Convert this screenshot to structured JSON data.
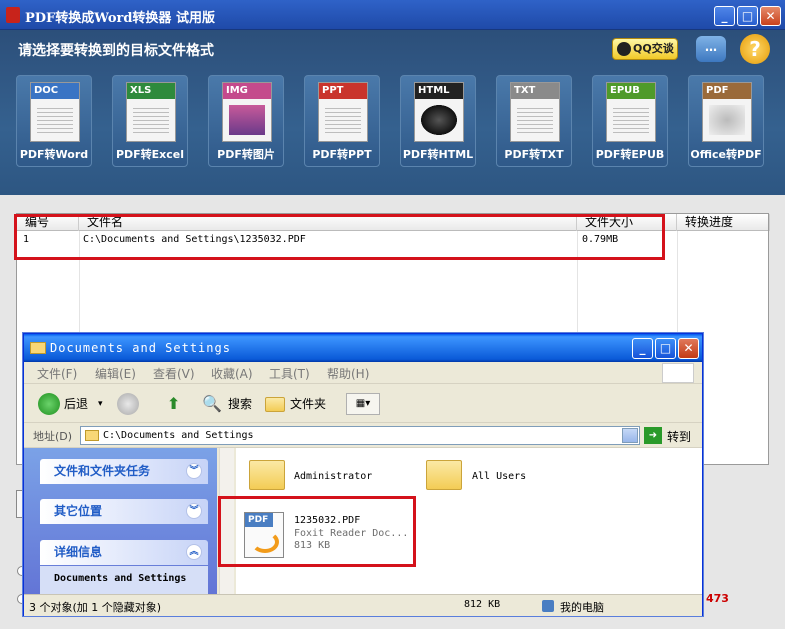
{
  "app": {
    "title": "PDF转换成Word转换器 试用版",
    "prompt": "请选择要转换到的目标文件格式",
    "qq_label": "QQ交谈",
    "help_label": "?",
    "conversions": [
      {
        "tag": "DOC",
        "label": "PDF转Word",
        "color": "#3a74c4"
      },
      {
        "tag": "XLS",
        "label": "PDF转Excel",
        "color": "#2e8a3c"
      },
      {
        "tag": "IMG",
        "label": "PDF转图片",
        "color": "#c44a8c"
      },
      {
        "tag": "PPT",
        "label": "PDF转PPT",
        "color": "#c9342c"
      },
      {
        "tag": "HTML",
        "label": "PDF转HTML",
        "color": "#222222"
      },
      {
        "tag": "TXT",
        "label": "PDF转TXT",
        "color": "#8a8a8a"
      },
      {
        "tag": "EPUB",
        "label": "PDF转EPUB",
        "color": "#4f9a2a"
      },
      {
        "tag": "PDF",
        "label": "Office转PDF",
        "color": "#9a6a3a"
      }
    ],
    "table": {
      "headers": [
        "编号",
        "文件名",
        "文件大小",
        "转换进度"
      ],
      "rows": [
        {
          "num": "1",
          "name": "C:\\Documents and Settings\\1235032.PDF",
          "size": "0.79MB",
          "progress": ""
        }
      ]
    },
    "status_right": "473",
    "highlight_color": "#d4121b"
  },
  "explorer": {
    "title": "Documents and Settings",
    "menu": [
      "文件(F)",
      "编辑(E)",
      "查看(V)",
      "收藏(A)",
      "工具(T)",
      "帮助(H)"
    ],
    "toolbar": {
      "back": "后退",
      "search": "搜索",
      "folders": "文件夹"
    },
    "address_label": "地址(D)",
    "address_value": "C:\\Documents and Settings",
    "go_label": "转到",
    "sidebar": [
      {
        "label": "文件和文件夹任务"
      },
      {
        "label": "其它位置"
      },
      {
        "label": "详细信息"
      }
    ],
    "details_text": "Documents and Settings",
    "items": [
      {
        "name": "Administrator"
      },
      {
        "name": "All Users"
      }
    ],
    "file": {
      "name": "1235032.PDF",
      "type": "Foxit Reader Doc...",
      "size": "813 KB",
      "tag": "PDF"
    },
    "status": {
      "objects": "3 个对象(加 1 个隐藏对象)",
      "size": "812 KB",
      "location": "我的电脑"
    }
  }
}
